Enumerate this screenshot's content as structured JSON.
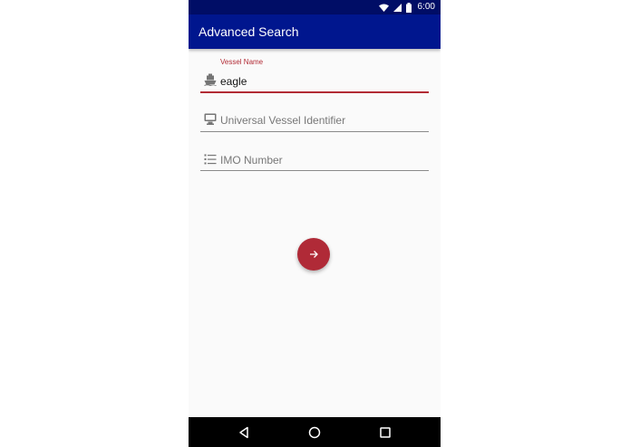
{
  "status_bar": {
    "time": "6:00",
    "icons": [
      "wifi-icon",
      "signal-icon",
      "battery-icon"
    ]
  },
  "app_bar": {
    "title": "Advanced Search"
  },
  "form": {
    "vessel_name": {
      "label": "Vessel Name",
      "value": "eagle",
      "icon": "ship-icon"
    },
    "uvi": {
      "placeholder": "Universal Vessel Identifier",
      "icon": "monitor-icon"
    },
    "imo": {
      "placeholder": "IMO Number",
      "icon": "list-icon"
    }
  },
  "fab": {
    "icon": "arrow-right-icon"
  },
  "nav_bar": {
    "icons": [
      "back-icon",
      "home-icon",
      "recents-icon"
    ]
  },
  "colors": {
    "primary": "#00168e",
    "status_bar": "#000d66",
    "accent": "#b02a37"
  }
}
